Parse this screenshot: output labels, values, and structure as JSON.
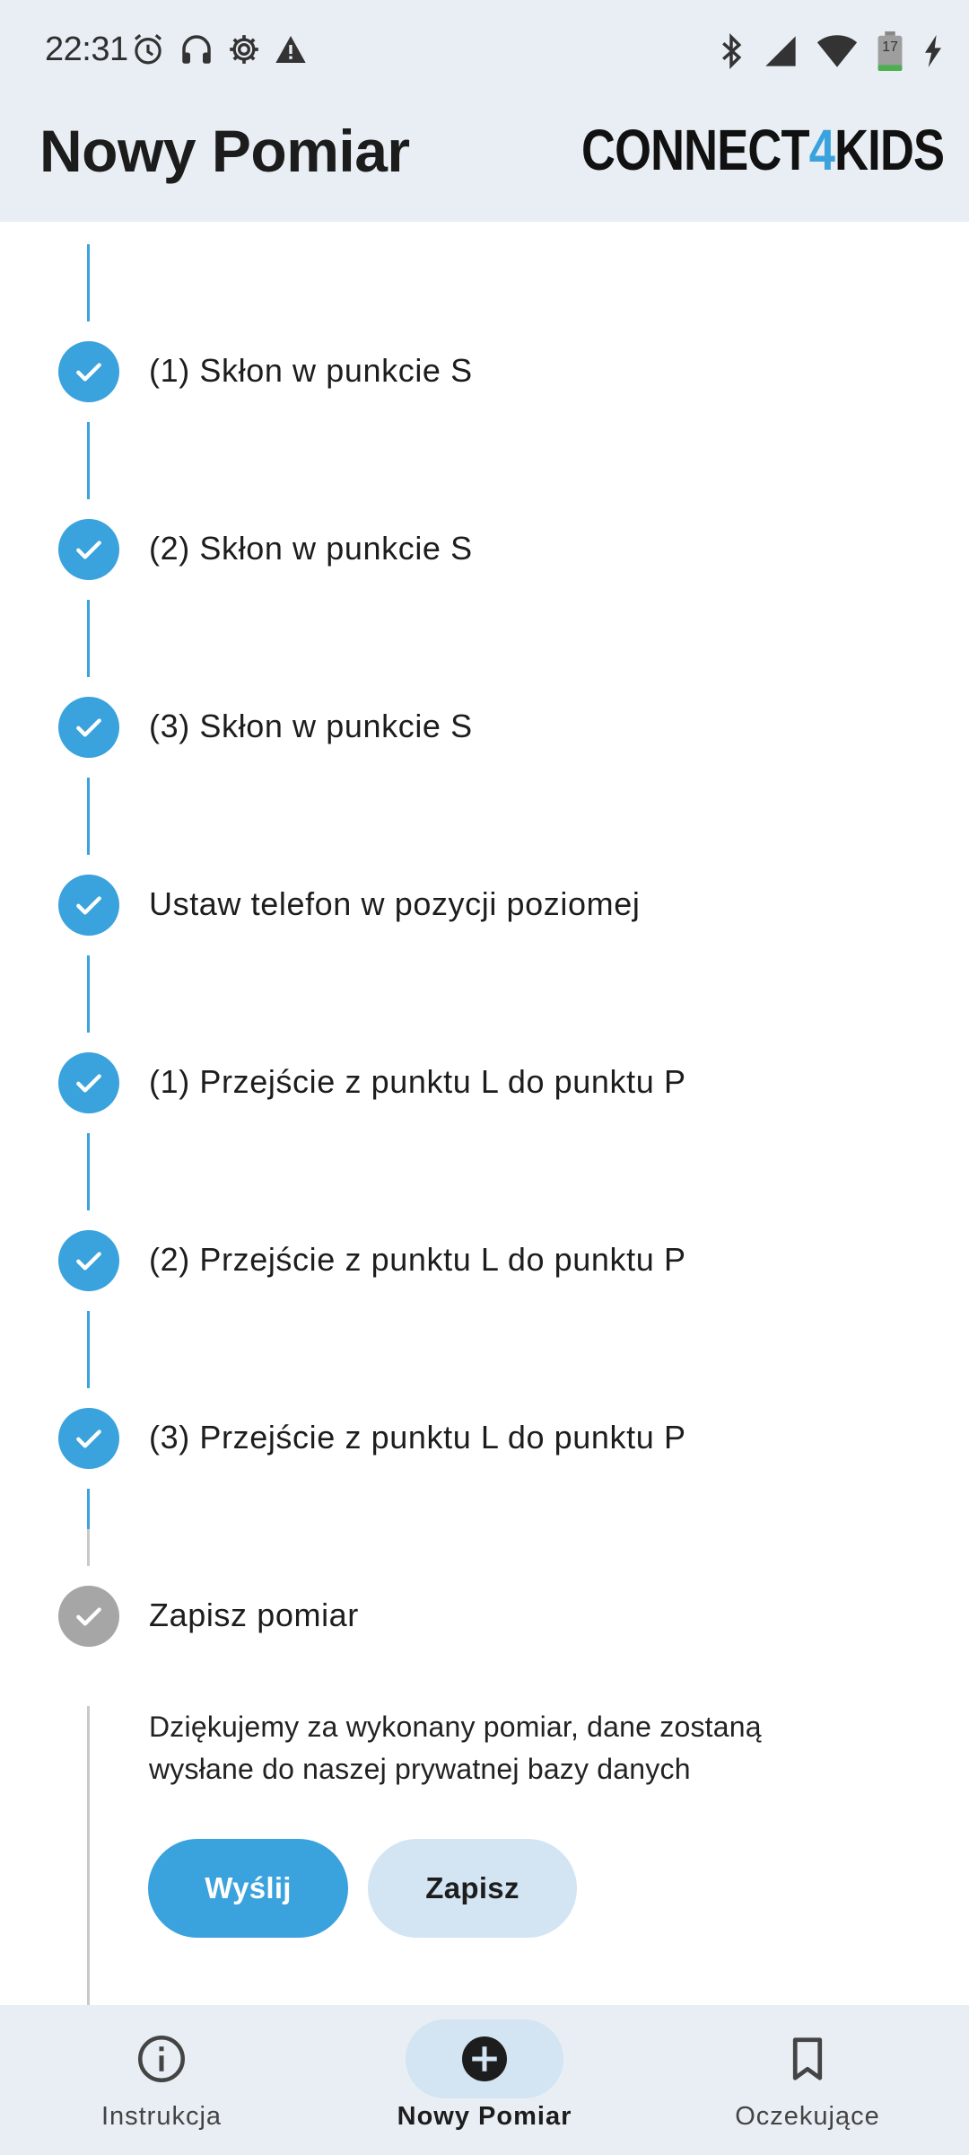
{
  "status_bar": {
    "time": "22:31",
    "battery_level": "17",
    "left_icons": [
      "alarm-icon",
      "headphones-icon",
      "settings-icon",
      "warning-icon"
    ],
    "right_icons": [
      "bluetooth-icon",
      "signal-icon",
      "wifi-icon",
      "battery-icon",
      "charging-icon"
    ]
  },
  "app_bar": {
    "title": "Nowy Pomiar",
    "brand_prefix": "CONNECT",
    "brand_accent": "4",
    "brand_suffix": "KIDS",
    "brand_accent_color": "#3aa2dc"
  },
  "stepper": {
    "steps": [
      {
        "label": "(1) Skłon w punkcie S",
        "status": "done"
      },
      {
        "label": "(2) Skłon w punkcie S",
        "status": "done"
      },
      {
        "label": "(3) Skłon w punkcie S",
        "status": "done"
      },
      {
        "label": "Ustaw telefon w pozycji poziomej",
        "status": "done"
      },
      {
        "label": "(1) Przejście z punktu L do punktu P",
        "status": "done"
      },
      {
        "label": "(2) Przejście z punktu L do punktu P",
        "status": "done"
      },
      {
        "label": "(3) Przejście z punktu L do punktu P",
        "status": "done"
      },
      {
        "label": "Zapisz pomiar",
        "status": "current"
      }
    ],
    "current_description": "Dziękujemy za wykonany pomiar, dane zostaną wysłane do naszej prywatnej bazy danych",
    "send_label": "Wyślij",
    "save_label": "Zapisz",
    "done_color": "#3aa2dc",
    "pending_color": "#a6a6a6"
  },
  "bottom_nav": {
    "items": [
      {
        "label": "Instrukcja",
        "icon": "info-icon",
        "active": false
      },
      {
        "label": "Nowy Pomiar",
        "icon": "add-circle-icon",
        "active": true
      },
      {
        "label": "Oczekujące",
        "icon": "bookmark-icon",
        "active": false
      }
    ]
  }
}
